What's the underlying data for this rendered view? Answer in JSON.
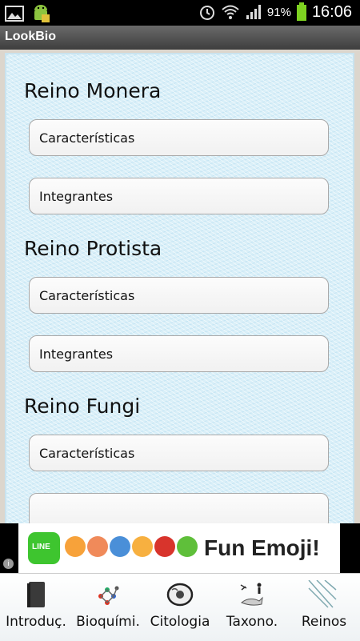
{
  "status_bar": {
    "battery_percent": "91%",
    "time": "16:06",
    "icons": [
      "image-icon",
      "android-icon",
      "alarm-icon",
      "wifi-icon",
      "signal-icon",
      "battery-icon"
    ]
  },
  "app": {
    "title": "LookBio"
  },
  "sections": [
    {
      "title": "Reino Monera",
      "buttons": [
        "Características",
        "Integrantes"
      ]
    },
    {
      "title": "Reino Protista",
      "buttons": [
        "Características",
        "Integrantes"
      ]
    },
    {
      "title": "Reino Fungi",
      "buttons": [
        "Características",
        ""
      ]
    }
  ],
  "ad": {
    "brand": "LINE",
    "text": "Fun Emoji!",
    "info": "i"
  },
  "tabs": [
    {
      "label": "Introduç.",
      "icon": "book-icon"
    },
    {
      "label": "Bioquími.",
      "icon": "molecule-icon"
    },
    {
      "label": "Citologia",
      "icon": "cell-icon"
    },
    {
      "label": "Taxono.",
      "icon": "taxonomy-icon"
    },
    {
      "label": "Reinos",
      "icon": "reinos-icon"
    }
  ]
}
